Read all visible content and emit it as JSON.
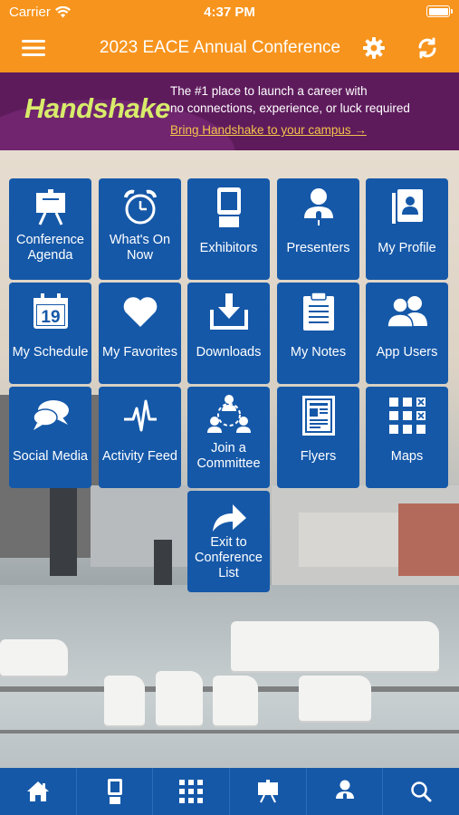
{
  "status_bar": {
    "carrier": "Carrier",
    "time": "4:37 PM"
  },
  "nav": {
    "title": "2023 EACE Annual Conference"
  },
  "banner": {
    "logo": "Handshake",
    "line1": "The #1 place to launch a career with",
    "line2": "no connections, experience, or luck required",
    "cta": "Bring Handshake to your campus →"
  },
  "tiles": [
    {
      "label": "Conference Agenda",
      "icon": "easel-icon"
    },
    {
      "label": "What's On Now",
      "icon": "alarm-clock-icon"
    },
    {
      "label": "Exhibitors",
      "icon": "booth-icon"
    },
    {
      "label": "Presenters",
      "icon": "presenter-icon"
    },
    {
      "label": "My Profile",
      "icon": "profile-card-icon"
    },
    {
      "label": "My Schedule",
      "icon": "calendar-icon"
    },
    {
      "label": "My Favorites",
      "icon": "heart-icon"
    },
    {
      "label": "Downloads",
      "icon": "download-icon"
    },
    {
      "label": "My Notes",
      "icon": "clipboard-icon"
    },
    {
      "label": "App Users",
      "icon": "users-icon"
    },
    {
      "label": "Social Media",
      "icon": "chat-bubbles-icon"
    },
    {
      "label": "Activity Feed",
      "icon": "pulse-icon"
    },
    {
      "label": "Join a Committee",
      "icon": "network-icon"
    },
    {
      "label": "Flyers",
      "icon": "flyer-icon"
    },
    {
      "label": "Maps",
      "icon": "map-grid-icon"
    },
    {
      "label": "Exit to Conference List",
      "icon": "share-arrow-icon"
    }
  ],
  "calendar_day": "19",
  "tab_bar": [
    "home-icon",
    "booth-icon",
    "grid-icon",
    "easel-icon",
    "presenter-icon",
    "search-icon"
  ],
  "colors": {
    "accent": "#f7941d",
    "tile": "#1558a8",
    "banner": "#5e1b5c",
    "banner_logo": "#d8ec6a",
    "banner_link": "#f4c34d"
  }
}
